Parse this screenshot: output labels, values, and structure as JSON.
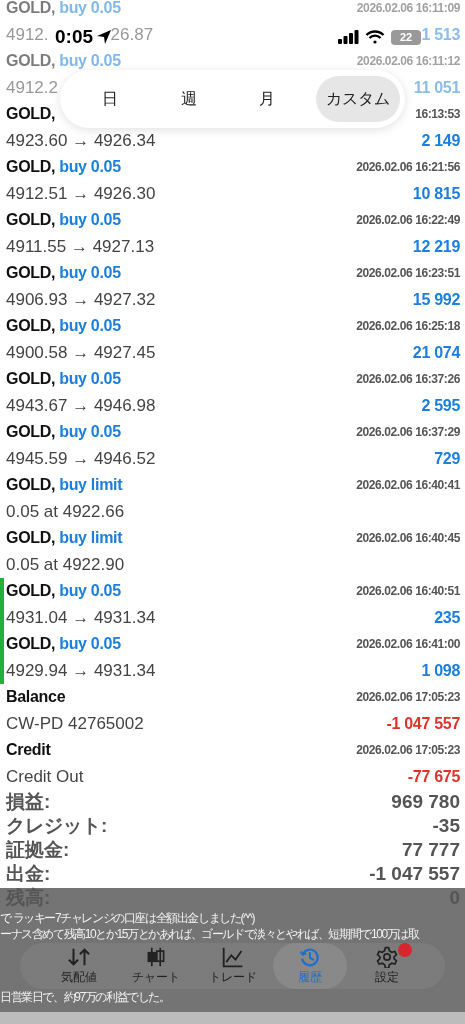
{
  "status_bar": {
    "time": "0:05",
    "battery": "22"
  },
  "period_tabs": [
    {
      "label": "日",
      "selected": false
    },
    {
      "label": "週",
      "selected": false
    },
    {
      "label": "月",
      "selected": false
    },
    {
      "label": "カスタム",
      "selected": true
    }
  ],
  "history": [
    {
      "kind": "trade",
      "dim": true,
      "marker": false,
      "title": "GOLD,",
      "side": "buy 0.05",
      "time": "2026.02.06 16:11:09",
      "detail": "4912.",
      "detail_end": "26.87",
      "value": "1 513",
      "color": "#8cbcec"
    },
    {
      "kind": "trade",
      "dim": true,
      "marker": false,
      "title": "GOLD,",
      "side": "buy 0.05",
      "time": "2026.02.06 16:11:12",
      "detail": "4912.2",
      "value": "11 051",
      "color": "#8cbcec"
    },
    {
      "kind": "trade",
      "dim": false,
      "marker": false,
      "title": "GOLD,",
      "time": "16:13:53",
      "detail": "4923.60 → 4926.34",
      "value": "2 149",
      "color": "#1a7fe0"
    },
    {
      "kind": "trade",
      "dim": false,
      "marker": false,
      "title": "GOLD,",
      "side": "buy 0.05",
      "time": "2026.02.06 16:21:56",
      "detail": "4912.51 → 4926.30",
      "value": "10 815",
      "color": "#1a7fe0"
    },
    {
      "kind": "trade",
      "dim": false,
      "marker": false,
      "title": "GOLD,",
      "side": "buy 0.05",
      "time": "2026.02.06 16:22:49",
      "detail": "4911.55 → 4927.13",
      "value": "12 219",
      "color": "#1a7fe0"
    },
    {
      "kind": "trade",
      "dim": false,
      "marker": false,
      "title": "GOLD,",
      "side": "buy 0.05",
      "time": "2026.02.06 16:23:51",
      "detail": "4906.93 → 4927.32",
      "value": "15 992",
      "color": "#1a7fe0"
    },
    {
      "kind": "trade",
      "dim": false,
      "marker": false,
      "title": "GOLD,",
      "side": "buy 0.05",
      "time": "2026.02.06 16:25:18",
      "detail": "4900.58 → 4927.45",
      "value": "21 074",
      "color": "#1a7fe0"
    },
    {
      "kind": "trade",
      "dim": false,
      "marker": false,
      "title": "GOLD,",
      "side": "buy 0.05",
      "time": "2026.02.06 16:37:26",
      "detail": "4943.67 → 4946.98",
      "value": "2 595",
      "color": "#1a7fe0"
    },
    {
      "kind": "trade",
      "dim": false,
      "marker": false,
      "title": "GOLD,",
      "side": "buy 0.05",
      "time": "2026.02.06 16:37:29",
      "detail": "4945.59 → 4946.52",
      "value": "729",
      "color": "#1a7fe0"
    },
    {
      "kind": "order",
      "dim": false,
      "marker": false,
      "title": "GOLD,",
      "side": "buy limit",
      "time": "2026.02.06 16:40:41",
      "detail": "0.05 at 4922.66"
    },
    {
      "kind": "order",
      "dim": false,
      "marker": false,
      "title": "GOLD,",
      "side": "buy limit",
      "time": "2026.02.06 16:40:45",
      "detail": "0.05 at 4922.90"
    },
    {
      "kind": "trade",
      "dim": false,
      "marker": true,
      "title": "GOLD,",
      "side": "buy 0.05",
      "time": "2026.02.06 16:40:51",
      "detail": "4931.04 → 4931.34",
      "value": "235",
      "color": "#1a7fe0"
    },
    {
      "kind": "trade",
      "dim": false,
      "marker": true,
      "title": "GOLD,",
      "side": "buy 0.05",
      "time": "2026.02.06 16:41:00",
      "detail": "4929.94 → 4931.34",
      "value": "1 098",
      "color": "#1a7fe0"
    },
    {
      "kind": "balance",
      "dim": false,
      "marker": false,
      "title": "Balance",
      "time": "2026.02.06 17:05:23",
      "detail": "CW-PD 42765002",
      "value": "-1 047 557",
      "color": "#e0332b"
    },
    {
      "kind": "balance",
      "dim": false,
      "marker": false,
      "title": "Credit",
      "time": "2026.02.06 17:05:23",
      "detail": "Credit Out",
      "value": "-77 675",
      "color": "#e0332b"
    }
  ],
  "summary": [
    {
      "label": "損益:",
      "value": "969 780"
    },
    {
      "label": "クレジット:",
      "value": "-35"
    },
    {
      "label": "証拠金:",
      "value": "77 777"
    },
    {
      "label": "出金:",
      "value": "-1 047 557"
    },
    {
      "label": "残高:",
      "value": "0"
    }
  ],
  "captions": [
    "で ラッキー7チャレンジの口座は全額出金しました(^^)",
    "ーナス含めて残高10とか15万とかあれば、ゴールドで淡々とやれば、短期間で100万は取",
    "日営業日で、約97万の利益でした。"
  ],
  "nav_tabs": [
    {
      "kind": "quotes",
      "label": "気配値",
      "selected": false,
      "badge": false
    },
    {
      "kind": "chart",
      "label": "チャート",
      "selected": false,
      "badge": false
    },
    {
      "kind": "trade",
      "label": "トレード",
      "selected": false,
      "badge": false
    },
    {
      "kind": "history",
      "label": "履歴",
      "selected": true,
      "badge": false
    },
    {
      "kind": "settings",
      "label": "設定",
      "selected": false,
      "badge": true
    }
  ]
}
